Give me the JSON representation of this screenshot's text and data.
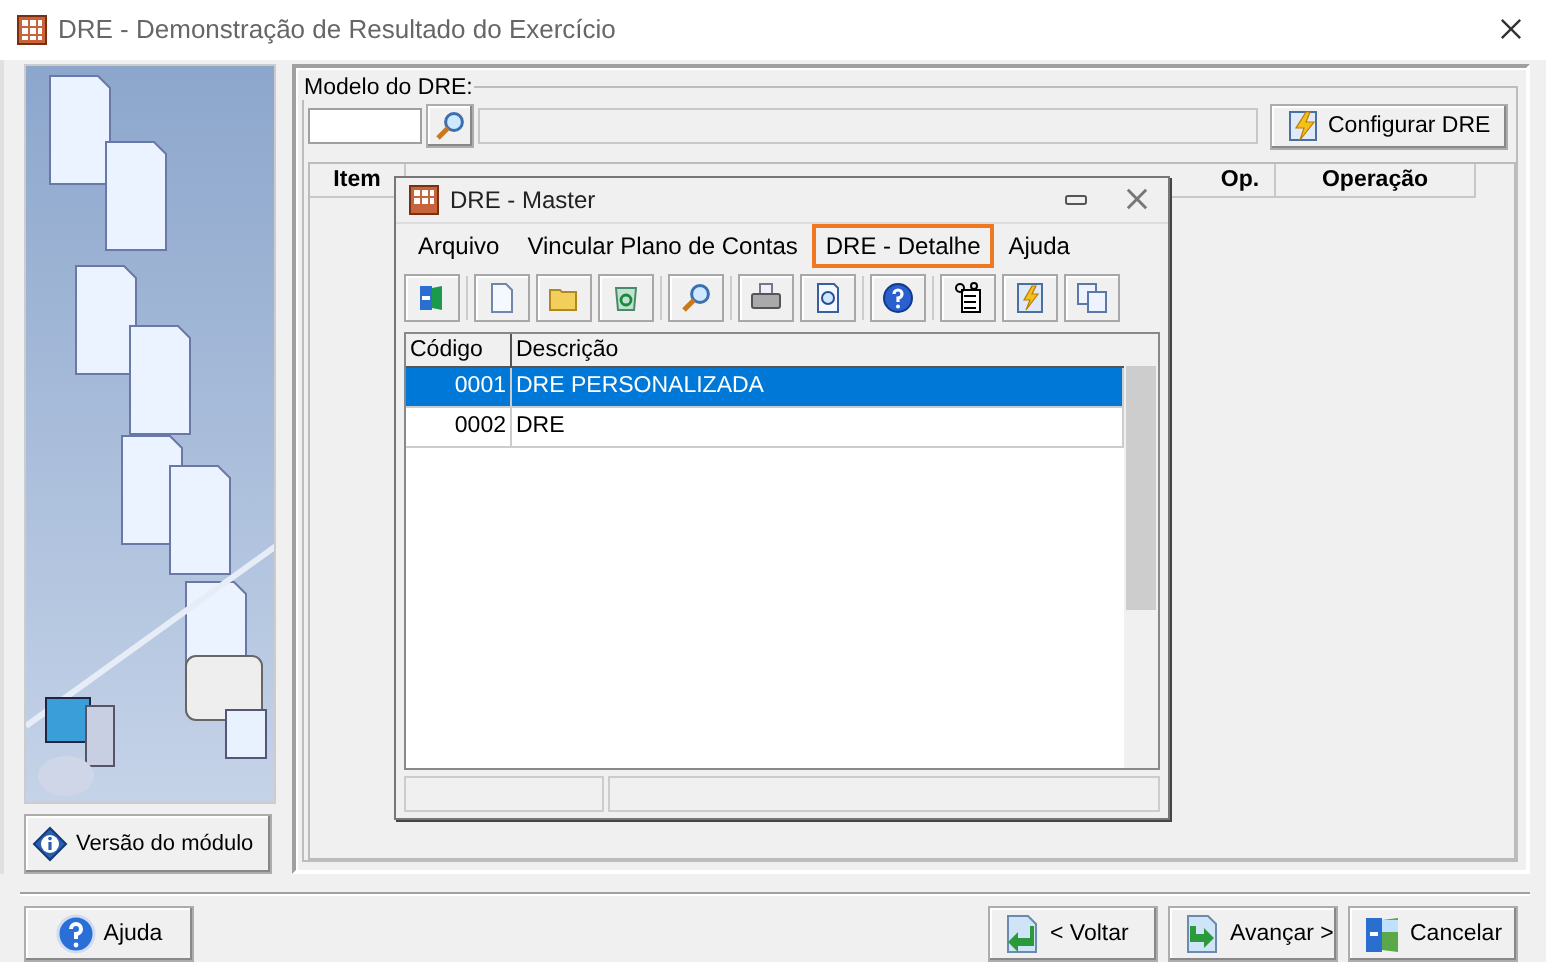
{
  "window": {
    "title": "DRE - Demonstração de Resultado do Exercício"
  },
  "side": {
    "version_button": "Versão do módulo"
  },
  "model_group": {
    "label": "Modelo do DRE:",
    "configure_button": "Configurar DRE"
  },
  "main_table": {
    "columns": [
      "Item",
      "Op.",
      "Operação"
    ]
  },
  "master": {
    "title": "DRE - Master",
    "menu": [
      {
        "label": "Arquivo",
        "highlighted": false
      },
      {
        "label": "Vincular Plano de Contas",
        "highlighted": false
      },
      {
        "label": "DRE - Detalhe",
        "highlighted": true
      },
      {
        "label": "Ajuda",
        "highlighted": false
      }
    ],
    "toolbar": [
      {
        "kind": "exit"
      },
      {
        "kind": "sep"
      },
      {
        "kind": "new"
      },
      {
        "kind": "open"
      },
      {
        "kind": "recycle"
      },
      {
        "kind": "sep"
      },
      {
        "kind": "search"
      },
      {
        "kind": "sep"
      },
      {
        "kind": "print"
      },
      {
        "kind": "preview"
      },
      {
        "kind": "sep"
      },
      {
        "kind": "help"
      },
      {
        "kind": "sep"
      },
      {
        "kind": "tree"
      },
      {
        "kind": "wizard"
      },
      {
        "kind": "copy"
      }
    ],
    "columns": [
      "Código",
      "Descrição"
    ],
    "rows": [
      {
        "code": "0001",
        "description": "DRE PERSONALIZADA",
        "selected": true
      },
      {
        "code": "0002",
        "description": "DRE",
        "selected": false
      }
    ]
  },
  "footer": {
    "buttons": [
      {
        "kind": "help",
        "label": "Ajuda"
      },
      {
        "kind": "back",
        "label": "< Voltar"
      },
      {
        "kind": "next",
        "label": "Avançar >"
      },
      {
        "kind": "cancel",
        "label": "Cancelar"
      }
    ]
  }
}
